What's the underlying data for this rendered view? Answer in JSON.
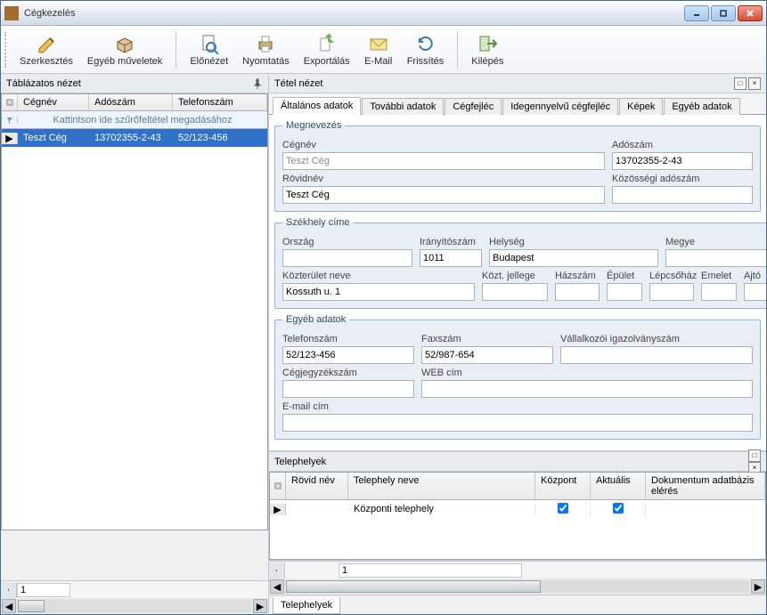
{
  "window": {
    "title": "Cégkezelés"
  },
  "toolbar": {
    "items": [
      {
        "label": "Szerkesztés"
      },
      {
        "label": "Egyéb műveletek"
      },
      {
        "sep": true
      },
      {
        "label": "Előnézet"
      },
      {
        "label": "Nyomtatás"
      },
      {
        "label": "Exportálás"
      },
      {
        "label": "E-Mail"
      },
      {
        "label": "Frissítés"
      },
      {
        "sep": true
      },
      {
        "label": "Kilépés"
      }
    ]
  },
  "left": {
    "title": "Táblázatos nézet",
    "columns": [
      "Cégnév",
      "Adószám",
      "Telefonszám"
    ],
    "filter_hint": "Kattintson ide szűrőfeltétel megadásához",
    "rows": [
      {
        "cegnev": "Teszt Cég",
        "adoszam": "13702355-2-43",
        "telefon": "52/123-456"
      }
    ],
    "page": "1"
  },
  "right": {
    "title": "Tétel nézet",
    "tabs": [
      "Általános adatok",
      "További adatok",
      "Cégfejléc",
      "Idegennyelvű cégfejléc",
      "Képek",
      "Egyéb adatok"
    ],
    "megnevezes": {
      "legend": "Megnevezés",
      "cegnev_label": "Cégnév",
      "cegnev": "Teszt Cég",
      "adoszam_label": "Adószám",
      "adoszam": "13702355-2-43",
      "rovidnev_label": "Rövidnév",
      "rovidnev": "Teszt Cég",
      "kozossegi_label": "Közösségi adószám",
      "kozossegi": ""
    },
    "szekhely": {
      "legend": "Székhely címe",
      "orszag_label": "Ország",
      "orszag": "",
      "irsz_label": "Irányítószám",
      "irsz": "1011",
      "helyseg_label": "Helység",
      "helyseg": "Budapest",
      "megye_label": "Megye",
      "megye": "",
      "kozterulet_label": "Közterület neve",
      "kozterulet": "Kossuth u. 1",
      "koztjellege_label": "Közt. jellege",
      "koztjellege": "",
      "hazszam_label": "Házszám",
      "hazszam": "",
      "epulet_label": "Épület",
      "epulet": "",
      "lepcsohaz_label": "Lépcsőház",
      "lepcsohaz": "",
      "emelet_label": "Emelet",
      "emelet": "",
      "ajto_label": "Ajtó",
      "ajto": ""
    },
    "egyeb": {
      "legend": "Egyéb adatok",
      "telefon_label": "Telefonszám",
      "telefon": "52/123-456",
      "fax_label": "Faxszám",
      "fax": "52/987-654",
      "vallig_label": "Vállalkozói igazolványszám",
      "vallig": "",
      "cegjegyzek_label": "Cégjegyzékszám",
      "cegjegyzek": "",
      "web_label": "WEB cím",
      "web": "",
      "email_label": "E-mail cím",
      "email": ""
    }
  },
  "sites": {
    "title": "Telephelyek",
    "columns": [
      "Rövid név",
      "Telephely neve",
      "Központ",
      "Aktuális",
      "Dokumentum adatbázis elérés"
    ],
    "rows": [
      {
        "rovid": "",
        "nev": "Központi telephely",
        "kozpont": true,
        "aktualis": true
      }
    ],
    "page": "1",
    "tab": "Telephelyek"
  }
}
